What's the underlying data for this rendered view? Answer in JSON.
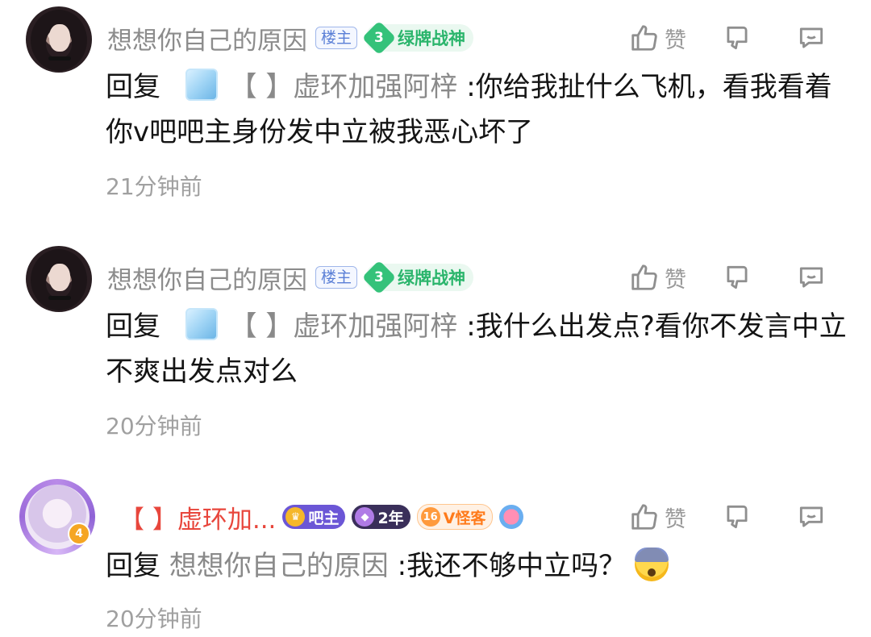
{
  "comments": [
    {
      "username": "想想你自己的原因",
      "badge_owner": "楼主",
      "badge_level": "3",
      "badge_title": "绿牌战神",
      "like_label": "赞",
      "reply_prefix": "回复",
      "reply_target": "【 】虚环加强阿梓",
      "text": ":你给我扯什么飞机，看我看着你v吧吧主身份发中立被我恶心坏了",
      "time": "21分钟前"
    },
    {
      "username": "想想你自己的原因",
      "badge_owner": "楼主",
      "badge_level": "3",
      "badge_title": "绿牌战神",
      "like_label": "赞",
      "reply_prefix": "回复",
      "reply_target": "【 】虚环加强阿梓",
      "text": ":我什么出发点?看你不发言中立不爽出发点对么",
      "time": "20分钟前"
    },
    {
      "username": "【 】虚环加...",
      "avatar_level": "4",
      "badge_role": "吧主",
      "badge_years": "2年",
      "badge_vip_level": "16",
      "badge_vip": "V怪客",
      "like_label": "赞",
      "reply_prefix": "回复",
      "reply_target": "想想你自己的原因",
      "text": ":我还不够中立吗？",
      "time": "20分钟前"
    }
  ],
  "icons": {
    "like": "thumbs-up-icon",
    "dislike": "thumbs-down-icon",
    "reply": "comment-icon",
    "emoji": "anxious-face-emoji"
  }
}
